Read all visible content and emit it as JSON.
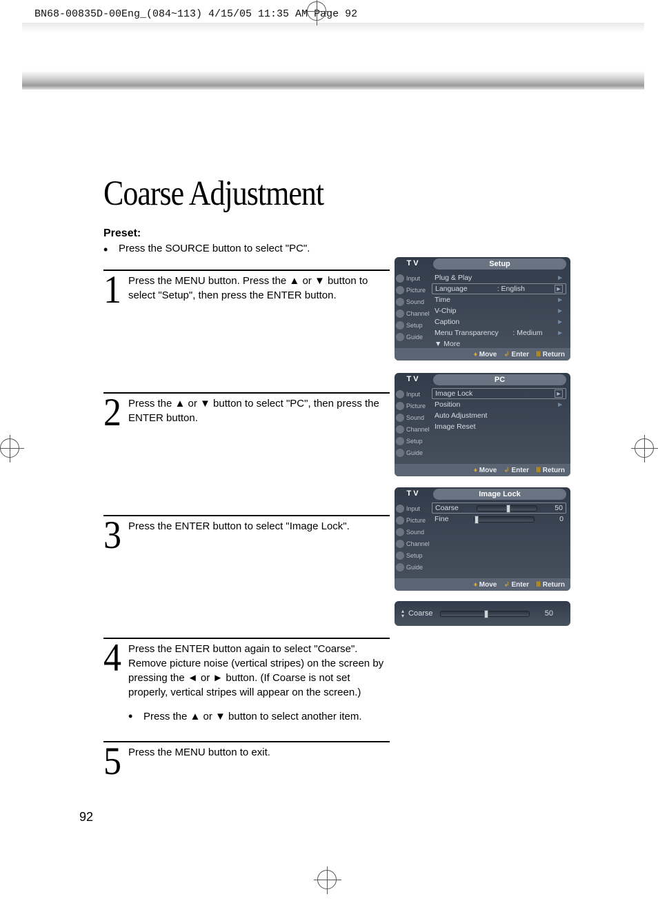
{
  "doc_header": "BN68-00835D-00Eng_(084~113)  4/15/05  11:35 AM  Page 92",
  "title": "Coarse Adjustment",
  "preset_label": "Preset:",
  "preset_text": "Press the SOURCE button to select \"PC\".",
  "steps": {
    "s1": {
      "num": "1",
      "text": "Press the MENU button. Press the ▲ or ▼ button to select \"Setup\", then press the ENTER button."
    },
    "s2": {
      "num": "2",
      "text": "Press the ▲ or ▼ button to select \"PC\", then press the ENTER button."
    },
    "s3": {
      "num": "3",
      "text": "Press the ENTER button to select \"Image Lock\"."
    },
    "s4": {
      "num": "4",
      "text": "Press the ENTER button again to select \"Coarse\". Remove picture noise (vertical stripes) on the screen by pressing the ◄ or ► button. (If Coarse is not set properly, vertical stripes will appear on the screen.)",
      "sub": "Press the ▲ or ▼ button to select another item."
    },
    "s5": {
      "num": "5",
      "text": "Press the MENU button to exit."
    }
  },
  "osd_side_items": [
    "Input",
    "Picture",
    "Sound",
    "Channel",
    "Setup",
    "Guide"
  ],
  "osd1": {
    "tv": "T V",
    "header": "Setup",
    "rows": {
      "r1": "Plug & Play",
      "r2a": "Language",
      "r2b": ": English",
      "r3": "Time",
      "r4": "V-Chip",
      "r5": "Caption",
      "r6a": "Menu Transparency",
      "r6b": ": Medium",
      "r7": "▼ More"
    }
  },
  "osd2": {
    "tv": "T V",
    "header": "PC",
    "rows": {
      "r1": "Image Lock",
      "r2": "Position",
      "r3": "Auto Adjustment",
      "r4": "Image Reset"
    }
  },
  "osd3": {
    "tv": "T V",
    "header": "Image Lock",
    "rows": {
      "r1a": "Coarse",
      "r1b": "50",
      "r2a": "Fine",
      "r2b": "0"
    }
  },
  "osd_footer": {
    "move": "Move",
    "enter": "Enter",
    "return": "Return"
  },
  "osd4": {
    "label": "Coarse",
    "value": "50"
  },
  "page_number": "92"
}
